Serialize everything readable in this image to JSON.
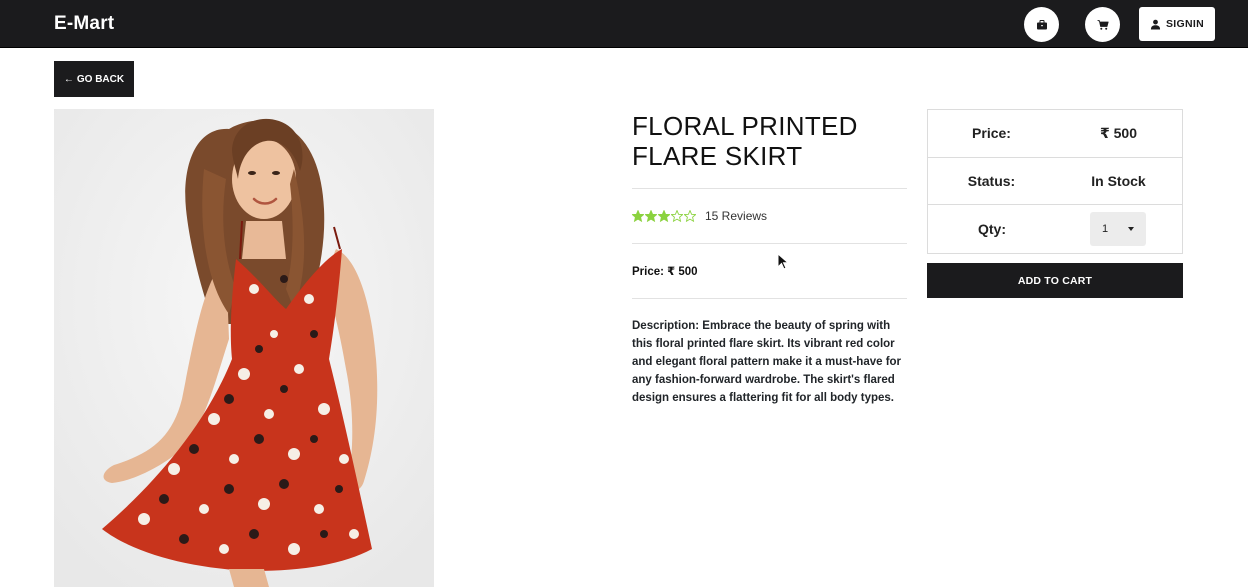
{
  "navbar": {
    "brand": "E-Mart",
    "signin_label": "SIGNIN",
    "icons": [
      "briefcase-icon",
      "cart-icon",
      "user-icon"
    ]
  },
  "goback_label": "GO BACK",
  "goback_arrow": "←",
  "product": {
    "title_line1": "FLORAL PRINTED",
    "title_line2": "FLARE SKIRT",
    "rating": 3,
    "rating_max": 5,
    "reviews_label": "15 Reviews",
    "price_label": "Price: ₹ 500",
    "description": "Description: Embrace the beauty of spring with this floral printed flare skirt. Its vibrant red color and elegant floral pattern make it a must-have for any fashion-forward wardrobe. The skirt's flared design ensures a flattering fit for all body types."
  },
  "summary": {
    "price_label": "Price:",
    "price_value": "₹ 500",
    "status_label": "Status:",
    "status_value": "In Stock",
    "qty_label": "Qty:",
    "qty_value": "1"
  },
  "add_to_cart_label": "ADD TO CART",
  "colors": {
    "navbar": "#1b1b1d",
    "star": "#8bd23f",
    "dress": "#c8341c"
  }
}
